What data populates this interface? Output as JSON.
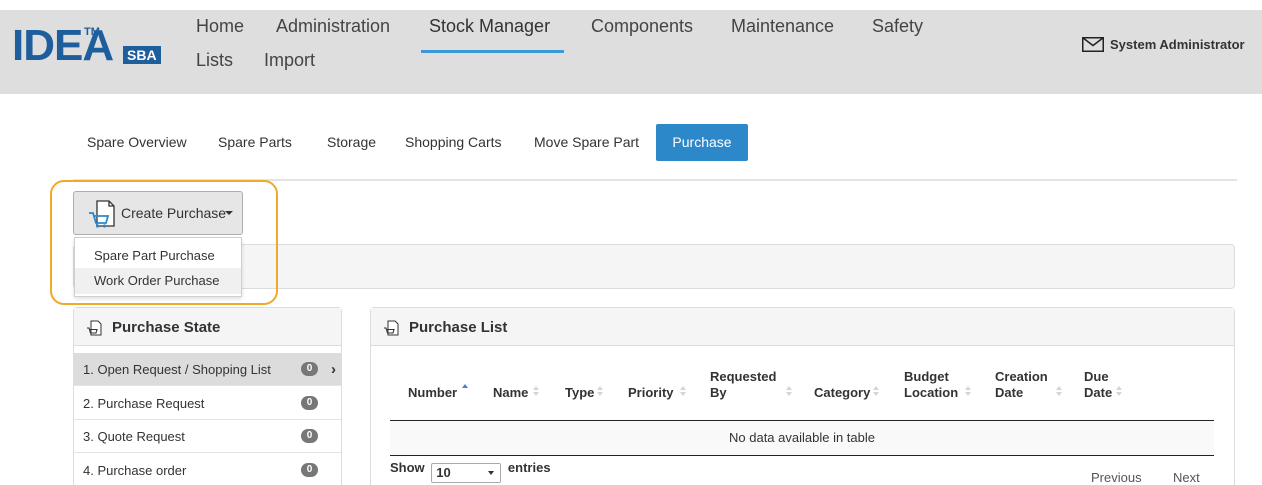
{
  "brand": {
    "name": "IDEA",
    "tm": "TM",
    "suffix": "SBA"
  },
  "nav": {
    "home": "Home",
    "administration": "Administration",
    "stock_manager": "Stock Manager",
    "components": "Components",
    "maintenance": "Maintenance",
    "safety": "Safety",
    "lists": "Lists",
    "import": "Import"
  },
  "user": {
    "name": "System Administrator"
  },
  "subtabs": {
    "spare_overview": "Spare Overview",
    "spare_parts": "Spare Parts",
    "storage": "Storage",
    "shopping_carts": "Shopping Carts",
    "move_spare_part": "Move Spare Part",
    "purchase": "Purchase"
  },
  "create_purchase": {
    "label": "Create Purchase",
    "options": [
      "Spare Part Purchase",
      "Work Order Purchase"
    ]
  },
  "purchase_state": {
    "title": "Purchase State",
    "rows": [
      {
        "label": "1. Open Request / Shopping List",
        "count": "0"
      },
      {
        "label": "2. Purchase Request",
        "count": "0"
      },
      {
        "label": "3. Quote Request",
        "count": "0"
      },
      {
        "label": "4. Purchase order",
        "count": "0"
      }
    ]
  },
  "purchase_list": {
    "title": "Purchase List",
    "columns": [
      {
        "l1": "Number",
        "l2": ""
      },
      {
        "l1": "Name",
        "l2": ""
      },
      {
        "l1": "Type",
        "l2": ""
      },
      {
        "l1": "Priority",
        "l2": ""
      },
      {
        "l1": "Requested",
        "l2": "By"
      },
      {
        "l1": "Category",
        "l2": ""
      },
      {
        "l1": "Budget",
        "l2": "Location"
      },
      {
        "l1": "Creation",
        "l2": "Date"
      },
      {
        "l1": "Due",
        "l2": "Date"
      }
    ],
    "empty_message": "No data available in table",
    "show_label": "Show",
    "page_size": "10",
    "entries_label": "entries",
    "previous": "Previous",
    "next": "Next"
  },
  "colors": {
    "accent": "#2d88c9",
    "highlight": "#f0a92a",
    "brand": "#1f5e9c"
  }
}
